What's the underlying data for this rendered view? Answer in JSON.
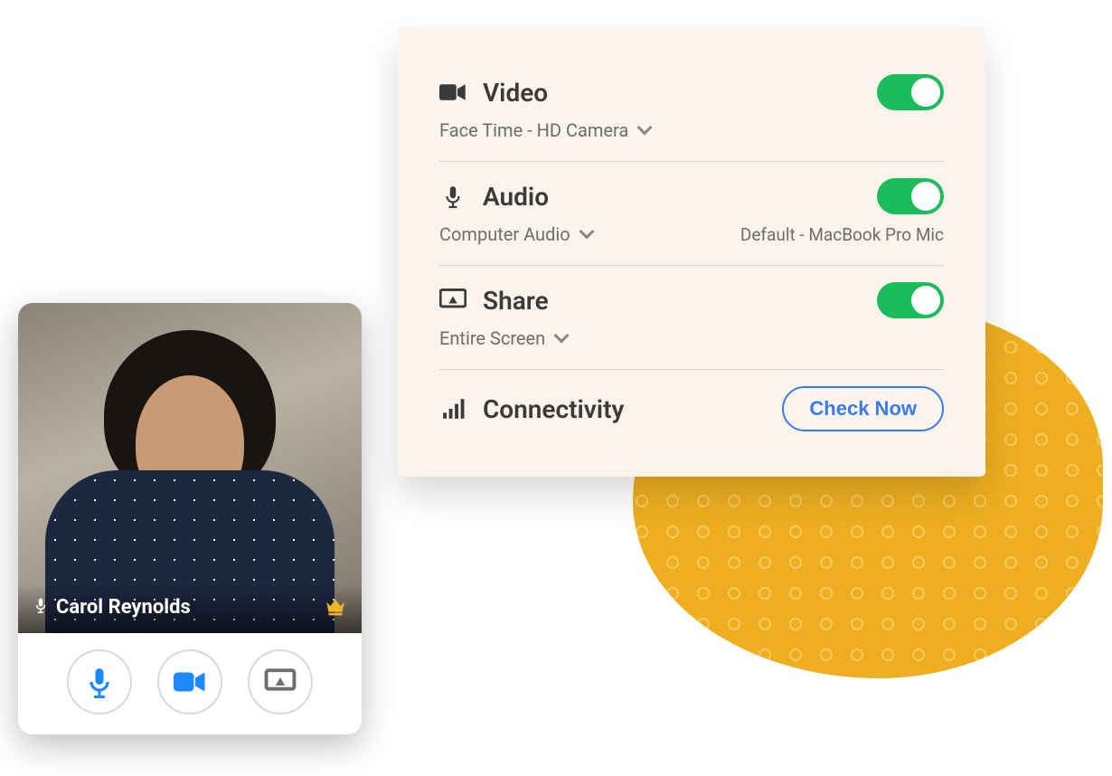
{
  "settings": {
    "video": {
      "title": "Video",
      "device": "Face Time - HD Camera",
      "enabled": true
    },
    "audio": {
      "title": "Audio",
      "output": "Computer Audio",
      "input": "Default - MacBook Pro Mic",
      "enabled": true
    },
    "share": {
      "title": "Share",
      "target": "Entire Screen",
      "enabled": true
    },
    "connectivity": {
      "title": "Connectivity",
      "button": "Check Now"
    }
  },
  "preview": {
    "participant_name": "Carol Reynolds"
  },
  "colors": {
    "accent_blue": "#1e88ff",
    "toggle_green": "#1abc5b",
    "blob_orange": "#eeae20",
    "panel_bg": "#fbf3ec"
  }
}
